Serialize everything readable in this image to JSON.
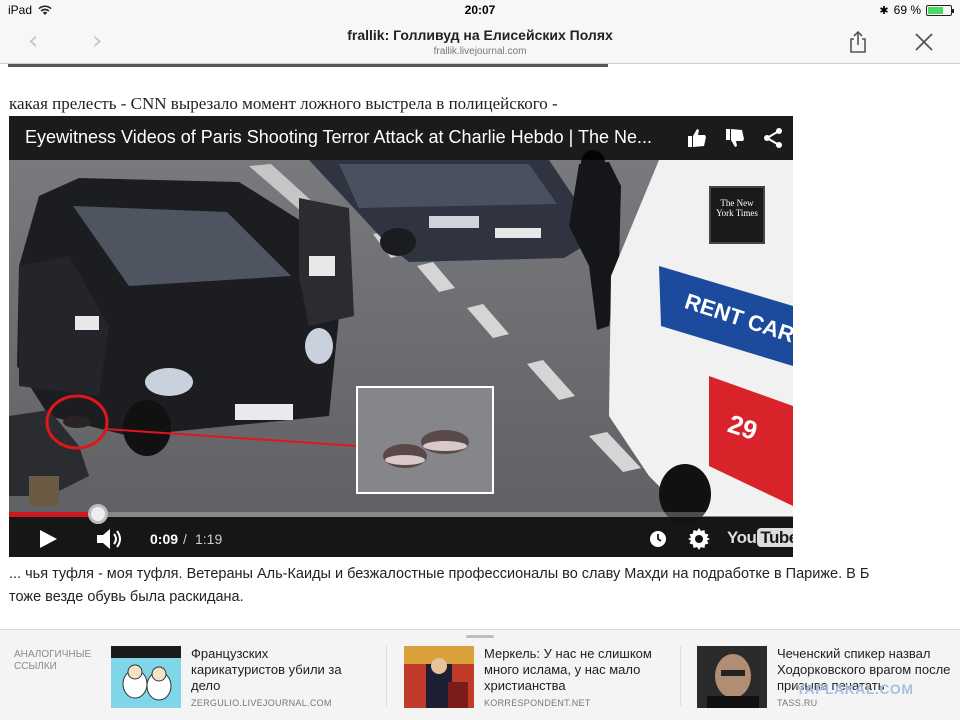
{
  "status_bar": {
    "device": "iPad",
    "time": "20:07",
    "battery": "69 %",
    "battery_level": 0.69,
    "icons": [
      "wifi-icon",
      "bluetooth-icon",
      "battery-icon"
    ]
  },
  "browser": {
    "title": "frallik: Голливуд на Елисейских Полях",
    "domain": "frallik.livejournal.com",
    "icons": [
      "chevron-left-icon",
      "chevron-right-icon",
      "share-icon",
      "close-icon"
    ]
  },
  "article": {
    "headline": "какая прелесть - CNN вырезало момент ложного выстрела в полицейского -",
    "body_line1": "... чья туфля - моя туфля. Ветераны Аль-Каиды и безжалостные профессионалы во славу Махди на подработке в Париже. В Б",
    "body_line2": "тоже везде обувь была раскидана."
  },
  "video": {
    "title": "Eyewitness Videos of Paris Shooting Terror Attack at Charlie Hebdo | The Ne...",
    "nyt_logo": "The New York Times",
    "nyt_logo_url": "nytimes.com",
    "van_text": "RENT CAR",
    "van_price": "29",
    "time_current": "0:09",
    "time_separator": "/",
    "time_total": "1:19",
    "progress_fraction": 0.114,
    "youtube_logo": "You",
    "youtube_logo_tube": "Tube",
    "colors": {
      "progress": "#cc181e",
      "callout": "#e0161c"
    }
  },
  "related": {
    "label": "АНАЛОГИЧНЫЕ ССЫЛКИ",
    "items": [
      {
        "title": "Французских карикатуристов убили за дело",
        "source": "ZERGULIO.LIVEJOURNAL.COM",
        "thumb": "charlie-hebdo-cartoon"
      },
      {
        "title": "Меркель: У нас не слишком много ислама, у нас мало христианства",
        "source": "KORRESPONDENT.NET",
        "thumb": "merkel-speech"
      },
      {
        "title": "Чеченский спикер назвал Ходорковского врагом после призыва печатать",
        "source": "TASS.RU",
        "thumb": "khodorkovsky-portrait"
      }
    ]
  },
  "watermark": "YAPLAKAL.COM"
}
